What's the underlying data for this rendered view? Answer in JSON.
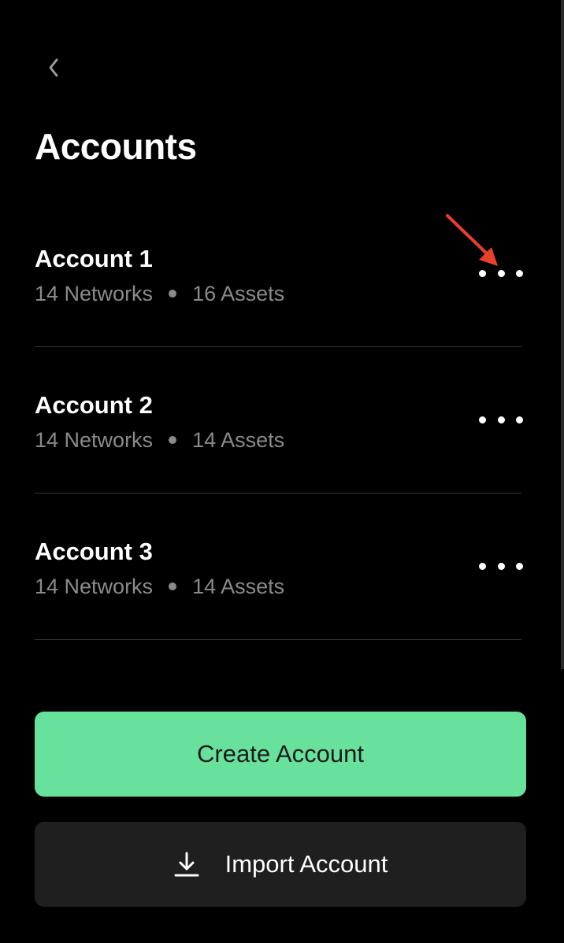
{
  "header": {
    "back_icon": "chevron-left-icon",
    "title": "Accounts"
  },
  "accounts": [
    {
      "name": "Account 1",
      "networks": "14 Networks",
      "assets": "16 Assets"
    },
    {
      "name": "Account 2",
      "networks": "14 Networks",
      "assets": "14 Assets"
    },
    {
      "name": "Account 3",
      "networks": "14 Networks",
      "assets": "14 Assets"
    }
  ],
  "actions": {
    "create_label": "Create Account",
    "import_label": "Import Account",
    "import_icon": "download-icon"
  },
  "colors": {
    "background": "#000000",
    "accent_green": "#68e19c",
    "secondary_button": "#1f1f1f",
    "muted_text": "#8a8a8a",
    "annotation_arrow": "#e8402a"
  }
}
